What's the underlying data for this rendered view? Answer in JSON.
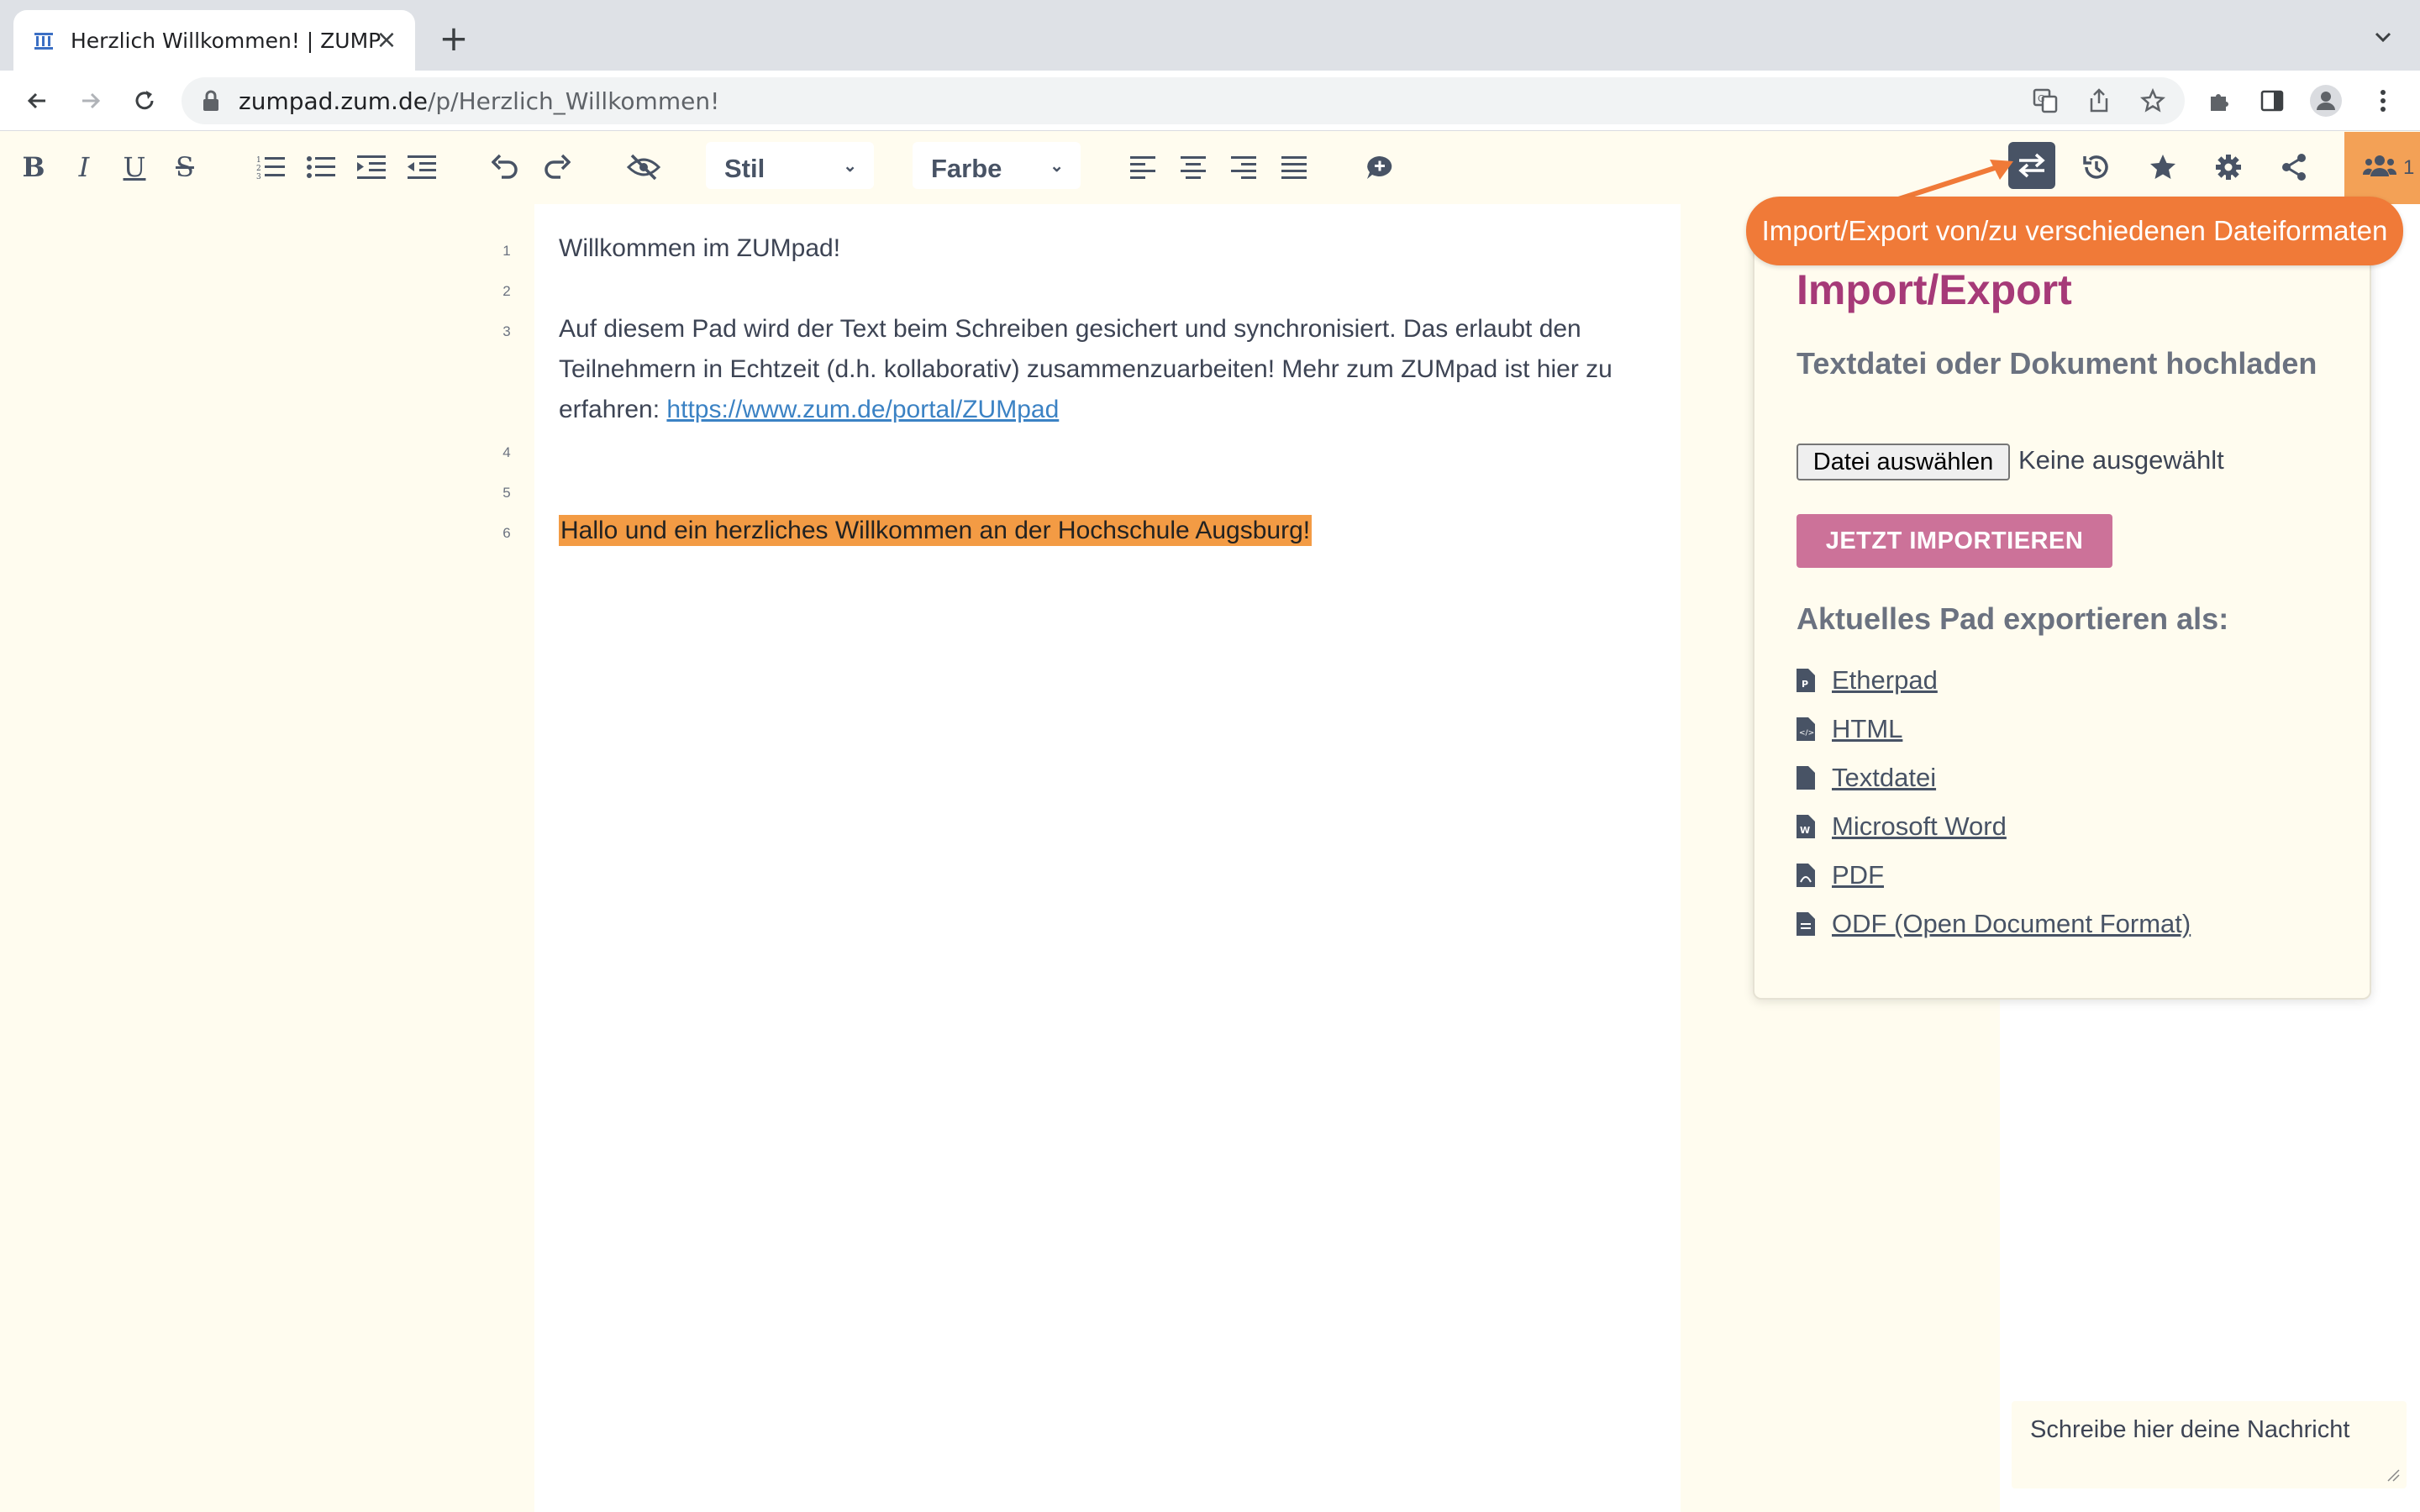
{
  "browser": {
    "tab_title": "Herzlich Willkommen! | ZUMPa",
    "url_host": "zumpad.zum.de",
    "url_path": "/p/Herzlich_Willkommen!"
  },
  "toolbar": {
    "style_select": "Stil",
    "color_select": "Farbe",
    "user_count": "1"
  },
  "editor": {
    "line_numbers": [
      "1",
      "2",
      "3",
      "4",
      "5",
      "6"
    ],
    "line1": "Willkommen im ZUMpad!",
    "line3_text": "Auf diesem Pad wird der Text beim Schreiben gesichert und synchronisiert. Das erlaubt den Teilnehmern in Echtzeit (d.h. kollaborativ) zusammenzuarbeiten! Mehr zum ZUMpad ist hier zu erfahren: ",
    "line3_link": "https://www.zum.de/portal/ZUMpad",
    "line6": "Hallo und ein herzliches Willkommen an der Hochschule Augsburg!",
    "highlight_color": "#f39b44"
  },
  "tooltip": {
    "text": "Import/Export von/zu verschiedenen Dateiformaten",
    "color": "#f07a38"
  },
  "import_export": {
    "title": "Import/Export",
    "upload_heading": "Textdatei oder Dokument hochladen",
    "file_button": "Datei auswählen",
    "file_status": "Keine ausgewählt",
    "import_button": "JETZT IMPORTIEREN",
    "export_heading": "Aktuelles Pad exportieren als:",
    "export_items": [
      {
        "label": "Etherpad",
        "icon": "etherpad-file-icon"
      },
      {
        "label": "HTML",
        "icon": "html-file-icon"
      },
      {
        "label": "Textdatei",
        "icon": "text-file-icon"
      },
      {
        "label": "Microsoft Word",
        "icon": "word-file-icon"
      },
      {
        "label": "PDF",
        "icon": "pdf-file-icon"
      },
      {
        "label": "ODF (Open Document Format)",
        "icon": "odf-file-icon"
      }
    ]
  },
  "chat": {
    "placeholder": "Schreibe hier deine Nachricht"
  }
}
